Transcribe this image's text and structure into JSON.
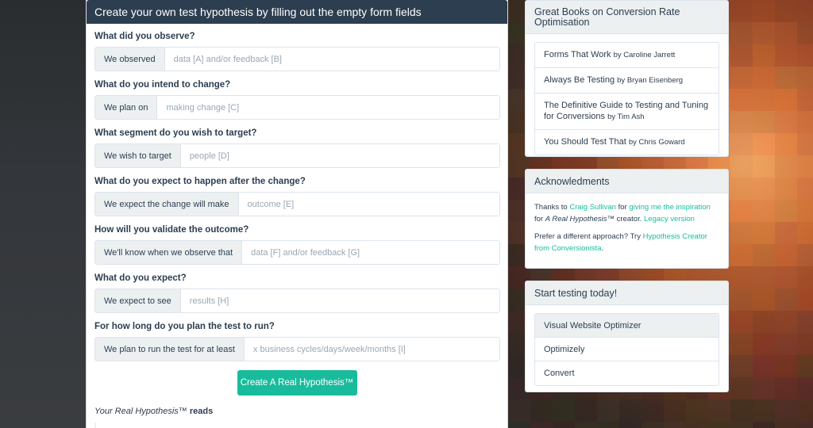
{
  "main": {
    "header": "Create your own test hypothesis by filling out the empty form fields",
    "questions": [
      {
        "label": "What did you observe?",
        "addon": "We observed",
        "placeholder": "data [A] and/or feedback [B]"
      },
      {
        "label": "What do you intend to change?",
        "addon": "We plan on",
        "placeholder": "making change [C]"
      },
      {
        "label": "What segment do you wish to target?",
        "addon": "We wish to target",
        "placeholder": "people [D]"
      },
      {
        "label": "What do you expect to happen after the change?",
        "addon": "We expect the change will make",
        "placeholder": "outcome [E]"
      },
      {
        "label": "How will you validate the outcome?",
        "addon": "We'll know when we observe that",
        "placeholder": "data [F] and/or feedback [G]"
      },
      {
        "label": "What do you expect?",
        "addon": "We expect to see",
        "placeholder": "results [H]"
      },
      {
        "label": "For how long do you plan the test to run?",
        "addon": "We plan to run the test for at least",
        "placeholder": "x business cycles/days/week/months [I]"
      }
    ],
    "button_label": "Create A Real Hypothesis™",
    "reads_prefix": "Your Real Hypothesis™",
    "reads_suffix": "reads"
  },
  "books": {
    "title": "Great Books on Conversion Rate Optimisation",
    "items": [
      {
        "title": "Forms That Work",
        "by": "by Caroline Jarrett"
      },
      {
        "title": "Always Be Testing",
        "by": "by Bryan Eisenberg"
      },
      {
        "title": "The Definitive Guide to Testing and Tuning for Conversions",
        "by": "by Tim Ash"
      },
      {
        "title": "You Should Test That",
        "by": "by Chris Goward"
      }
    ]
  },
  "acknowledgments": {
    "title": "Acknowledments",
    "thanks_to": "Thanks to",
    "person_link": "Craig Sullivan",
    "for_1": "for",
    "inspiration_link": "giving me the inspiration",
    "for_2": "for",
    "creator_italic": "A Real Hypothesis",
    "creator_suffix": "™ creator.",
    "legacy_link": "Legacy version",
    "prefer_text": "Prefer a different approach? Try",
    "hypothesis_link": "Hypothesis Creator from Conversionista",
    "period": "."
  },
  "start": {
    "title": "Start testing today!",
    "items": [
      "Visual Website Optimizer",
      "Optimizely",
      "Convert"
    ]
  },
  "colors": {
    "header_bg": "#2c3e50",
    "accent": "#18bc9c",
    "panel_head_bg": "#ecf0f1"
  }
}
